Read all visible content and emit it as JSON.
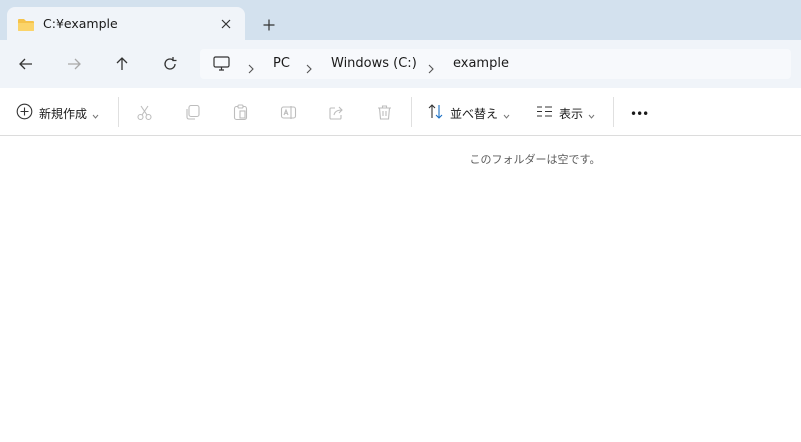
{
  "window": {
    "tab": {
      "title": "C:¥example",
      "icon": "folder-icon"
    }
  },
  "navigation": {
    "buttons": [
      "back-arrow-icon",
      "forward-arrow-icon",
      "up-arrow-icon",
      "refresh-icon"
    ],
    "breadcrumb": [
      "PC",
      "Windows (C:)",
      "example"
    ],
    "root_icon": "monitor-icon"
  },
  "toolbar": {
    "new_label": "新規作成",
    "sort_label": "並べ替え",
    "view_label": "表示",
    "more_label": "•••",
    "disabled_icons": [
      "cut-icon",
      "copy-icon",
      "paste-icon",
      "rename-icon",
      "share-icon",
      "delete-icon"
    ]
  },
  "content": {
    "empty_message": "このフォルダーは空です。"
  },
  "colors": {
    "titlebar": "#d3e1ee",
    "navbar": "#f0f4f9",
    "accent": "#1a6fc4",
    "folder": "#f5c34b"
  }
}
